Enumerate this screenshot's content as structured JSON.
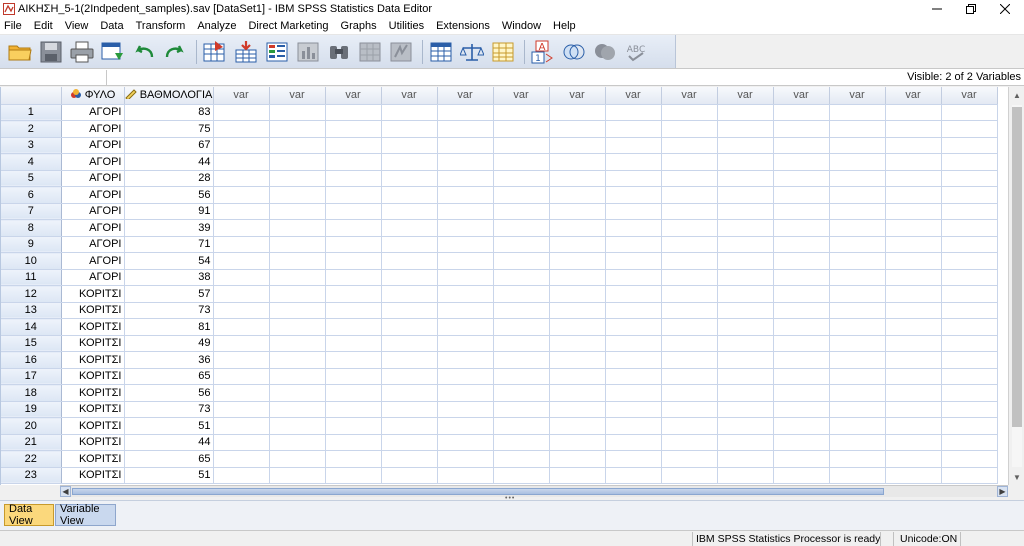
{
  "window": {
    "title": "ΑΙΚΗΣΗ_5-1(2Indpedent_samples).sav [DataSet1] - IBM SPSS Statistics Data Editor"
  },
  "menu": [
    "File",
    "Edit",
    "View",
    "Data",
    "Transform",
    "Analyze",
    "Direct Marketing",
    "Graphs",
    "Utilities",
    "Extensions",
    "Window",
    "Help"
  ],
  "toolbar": {
    "icons": [
      "open-folder-icon",
      "save-icon",
      "print-icon",
      "recall-dialog-icon",
      "undo-icon",
      "redo-icon",
      "goto-case-icon",
      "goto-variable-icon",
      "variables-icon",
      "run-descriptives-icon",
      "find-icon",
      "insert-cases-icon",
      "insert-variable-icon",
      "split-file-icon",
      "weight-cases-icon",
      "select-cases-icon",
      "value-labels-icon",
      "use-variable-sets-icon",
      "show-all-variables-icon",
      "spell-check-icon"
    ]
  },
  "cellbar": {
    "visible_text": "Visible: 2 of 2 Variables"
  },
  "grid": {
    "columns": [
      "ΦΥΛΟ",
      "ΒΑΘΜΟΛΟΓΙΑ",
      "var",
      "var",
      "var",
      "var",
      "var",
      "var",
      "var",
      "var",
      "var",
      "var",
      "var",
      "var",
      "var",
      "var"
    ],
    "rows": [
      [
        "1",
        "ΑΓΟΡΙ",
        "83"
      ],
      [
        "2",
        "ΑΓΟΡΙ",
        "75"
      ],
      [
        "3",
        "ΑΓΟΡΙ",
        "67"
      ],
      [
        "4",
        "ΑΓΟΡΙ",
        "44"
      ],
      [
        "5",
        "ΑΓΟΡΙ",
        "28"
      ],
      [
        "6",
        "ΑΓΟΡΙ",
        "56"
      ],
      [
        "7",
        "ΑΓΟΡΙ",
        "91"
      ],
      [
        "8",
        "ΑΓΟΡΙ",
        "39"
      ],
      [
        "9",
        "ΑΓΟΡΙ",
        "71"
      ],
      [
        "10",
        "ΑΓΟΡΙ",
        "54"
      ],
      [
        "11",
        "ΑΓΟΡΙ",
        "38"
      ],
      [
        "12",
        "ΚΟΡΙΤΣΙ",
        "57"
      ],
      [
        "13",
        "ΚΟΡΙΤΣΙ",
        "73"
      ],
      [
        "14",
        "ΚΟΡΙΤΣΙ",
        "81"
      ],
      [
        "15",
        "ΚΟΡΙΤΣΙ",
        "49"
      ],
      [
        "16",
        "ΚΟΡΙΤΣΙ",
        "36"
      ],
      [
        "17",
        "ΚΟΡΙΤΣΙ",
        "65"
      ],
      [
        "18",
        "ΚΟΡΙΤΣΙ",
        "56"
      ],
      [
        "19",
        "ΚΟΡΙΤΣΙ",
        "73"
      ],
      [
        "20",
        "ΚΟΡΙΤΣΙ",
        "51"
      ],
      [
        "21",
        "ΚΟΡΙΤΣΙ",
        "44"
      ],
      [
        "22",
        "ΚΟΡΙΤΣΙ",
        "65"
      ],
      [
        "23",
        "ΚΟΡΙΤΣΙ",
        "51"
      ]
    ]
  },
  "tabs": {
    "data_view": "Data View",
    "variable_view": "Variable View"
  },
  "status": {
    "processor": "IBM SPSS Statistics Processor is ready",
    "encoding": "Unicode:ON"
  },
  "colors": {
    "grid_line": "#c9d5ea",
    "active_tab": "#fbd87c",
    "inactive_tab": "#c9d8ee"
  }
}
